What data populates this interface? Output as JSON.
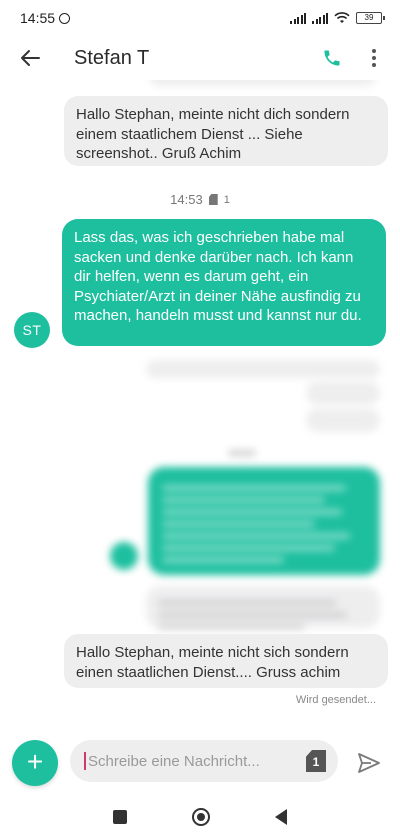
{
  "status_bar": {
    "time": "14:55",
    "battery": "39"
  },
  "app_bar": {
    "title": "Stefan T"
  },
  "messages": {
    "incoming_1": "Hallo Stephan, meinte nicht dich sondern einem staatlichem Dienst ... Siehe screenshot..  Gruß Achim",
    "timestamp_1": {
      "time": "14:53",
      "sim": "1"
    },
    "outgoing_1": "Lass das, was ich geschrieben habe mal sacken und denke darüber nach. Ich kann dir helfen, wenn es darum geht, ein Psychiater/Arzt in deiner Nähe ausfindig zu machen, handeln musst und kannst nur du.",
    "outgoing_1_avatar": "ST",
    "incoming_2": "Hallo Stephan, meinte nicht sich sondern einen staatlichen Dienst.... Gruss achim",
    "sending_status": "Wird gesendet..."
  },
  "compose": {
    "placeholder": "Schreibe eine Nachricht...",
    "sim": "1"
  },
  "colors": {
    "accent": "#1dbf9f",
    "incoming_bubble": "#eeeeef"
  },
  "icons": {
    "back": "arrow-back-icon",
    "call": "phone-icon",
    "more": "more-vert-icon",
    "add": "plus-icon",
    "send": "send-icon",
    "sim": "sim-card-icon"
  }
}
